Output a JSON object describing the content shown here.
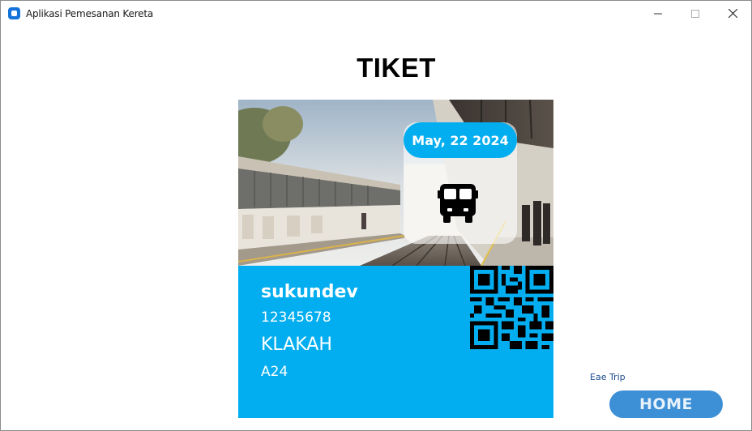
{
  "window": {
    "title": "Aplikasi Pemesanan Kereta"
  },
  "page": {
    "title": "TIKET"
  },
  "ticket": {
    "date": "May, 22 2024",
    "vehicle_icon": "bus-icon",
    "passenger_name": "sukundev",
    "passenger_id": "12345678",
    "destination": "KLAKAH",
    "seat": "A24"
  },
  "footer": {
    "trip_label": "Eae Trip",
    "home_label": "HOME"
  },
  "colors": {
    "accent": "#02aeef",
    "home_button": "#3d8fd6",
    "trip_label": "#1a4a8c"
  }
}
